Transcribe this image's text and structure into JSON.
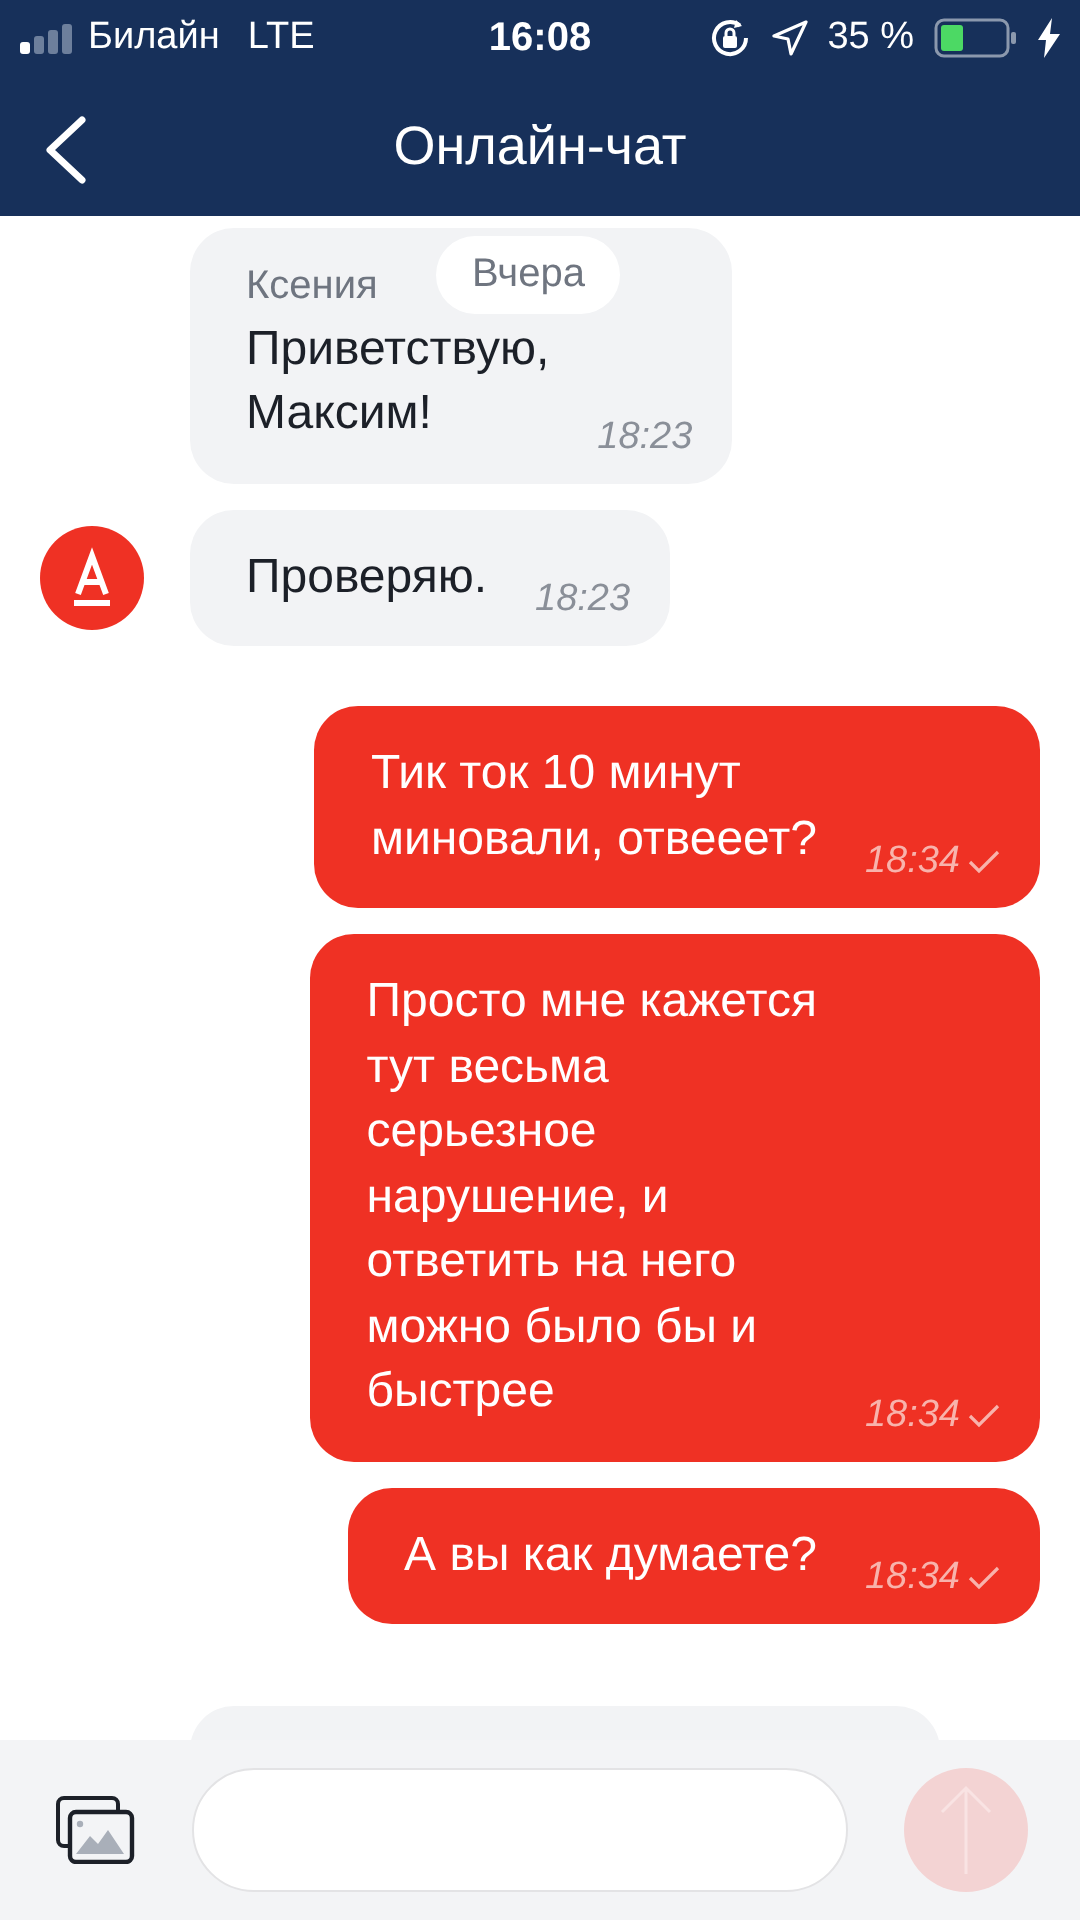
{
  "status_bar": {
    "carrier": "Билайн",
    "network": "LTE",
    "time": "16:08",
    "battery_percent": "35 %"
  },
  "nav_bar": {
    "title": "Онлайн-чат"
  },
  "date_chip": "Вчера",
  "messages": [
    {
      "kind": "incoming",
      "sender": "Ксения",
      "text": "Приветствую,\nМаксим!",
      "time": "18:23",
      "avatar": false
    },
    {
      "kind": "incoming",
      "text": "Проверяю.",
      "time": "18:23",
      "avatar": true
    },
    {
      "kind": "outgoing",
      "text": "Тик ток 10 минут\nминовали, отвееет?",
      "time": "18:34",
      "delivered": true
    },
    {
      "kind": "outgoing",
      "text": "Просто мне кажется\nтут весьма\nсерьезное\nнарушение, и\nответить на него\nможно было бы и\nбыстрее",
      "time": "18:34",
      "delivered": true
    },
    {
      "kind": "outgoing",
      "text": "А вы как думаете?",
      "time": "18:34",
      "delivered": true
    },
    {
      "kind": "incoming_partial"
    }
  ],
  "composer": {
    "send_disabled": true
  }
}
